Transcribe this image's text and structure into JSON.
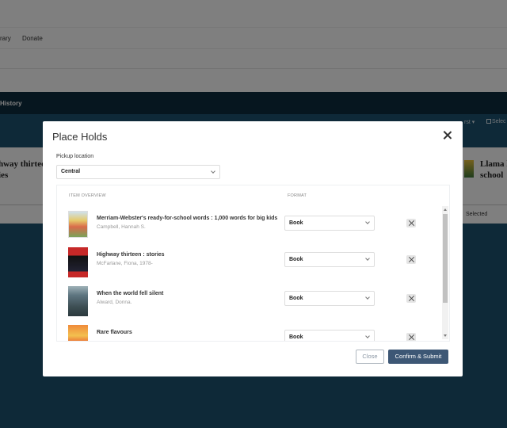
{
  "background": {
    "nav_items": [
      "rary",
      "Donate"
    ],
    "dark_bar_tab": "History",
    "sort_label": "rst ▾",
    "select_all_label": "Selec",
    "left_card_title_line1": "hway thirtee",
    "left_card_title_line2": "ies",
    "right_card_title_line1": "Llama l",
    "right_card_title_line2": "school",
    "right_selected_label": "Selected"
  },
  "modal": {
    "title": "Place Holds",
    "pickup_label": "Pickup location",
    "pickup_value": "Central",
    "columns": {
      "overview": "ITEM OVERVIEW",
      "format": "FORMAT"
    },
    "items": [
      {
        "title": "Merriam-Webster's ready-for-school words : 1,000 words for big kids",
        "author": "Campbell, Hannah S.",
        "format": "Book"
      },
      {
        "title": "Highway thirteen : stories",
        "author": "McFarlane, Fiona, 1978-",
        "format": "Book"
      },
      {
        "title": "When the world fell silent",
        "author": "Alward, Donna.",
        "format": "Book"
      },
      {
        "title": "Rare flavours",
        "author": "",
        "format": "Book"
      }
    ],
    "buttons": {
      "close": "Close",
      "confirm": "Confirm & Submit"
    }
  }
}
